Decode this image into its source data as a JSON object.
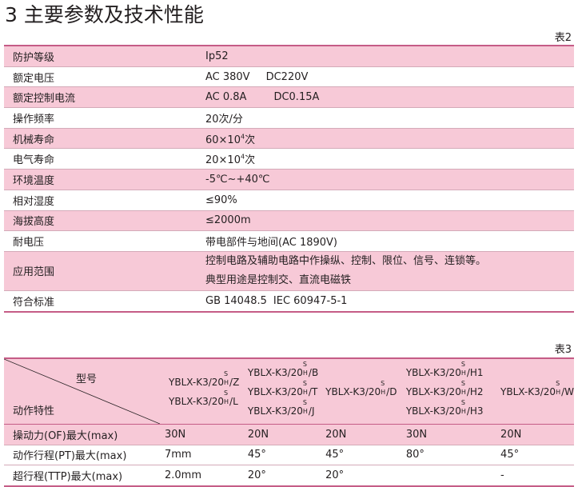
{
  "title": "3 主要参数及技术性能",
  "table2": {
    "tag": "表2",
    "rows": [
      {
        "key": "防护等级",
        "value": "Ip52"
      },
      {
        "key": "额定电压",
        "value_a": "AC 380V",
        "value_b": "DC220V"
      },
      {
        "key": "额定控制电流",
        "value_a": "AC 0.8A",
        "value_b": "DC0.15A"
      },
      {
        "key": "操作频率",
        "value": "20次/分"
      },
      {
        "key": "机械寿命",
        "value_pre": "60×10",
        "value_sup": "4",
        "value_post": "次"
      },
      {
        "key": "电气寿命",
        "value_pre": "20×10",
        "value_sup": "4",
        "value_post": "次"
      },
      {
        "key": "环境温度",
        "value": "-5℃~+40℃"
      },
      {
        "key": "相对湿度",
        "value": "≤90%"
      },
      {
        "key": "海拔高度",
        "value": "≤2000m"
      },
      {
        "key": "耐电压",
        "value": "带电部件与地间(AC 1890V)"
      },
      {
        "key": "应用范围",
        "value_line1": "控制电路及辅助电路中作操纵、控制、限位、信号、连锁等。",
        "value_line2": "典型用途是控制交、直流电磁铁"
      },
      {
        "key": "符合标准",
        "value_a": "GB 14048.5",
        "value_b": "IEC 60947-5-1"
      }
    ]
  },
  "table3": {
    "tag": "表3",
    "header_type_label": "型号",
    "header_action_label": "动作特性",
    "subscript_s": "S",
    "subscript_h": "H",
    "models": {
      "prefix": "YBLX-K3/20",
      "col1": [
        "/Z",
        "/L"
      ],
      "col2": [
        "/B",
        "/T",
        "/J"
      ],
      "col3": [
        "/D"
      ],
      "col4": [
        "/H1",
        "/H2",
        "/H3"
      ],
      "col5": [
        "/W"
      ]
    },
    "rows": [
      {
        "label": "操动力(OF)最大(max)",
        "values": [
          "30N",
          "20N",
          "20N",
          "30N",
          "20N"
        ]
      },
      {
        "label": "动作行程(PT)最大(max)",
        "values": [
          "7mm",
          "45°",
          "45°",
          "80°",
          "45°"
        ]
      },
      {
        "label": "超行程(TTP)最大(max)",
        "values": [
          "2.0mm",
          "20°",
          "20°",
          "",
          "-"
        ]
      }
    ]
  },
  "colors": {
    "accent": "#c55c86",
    "pink_fill": "#f7c9d7"
  }
}
